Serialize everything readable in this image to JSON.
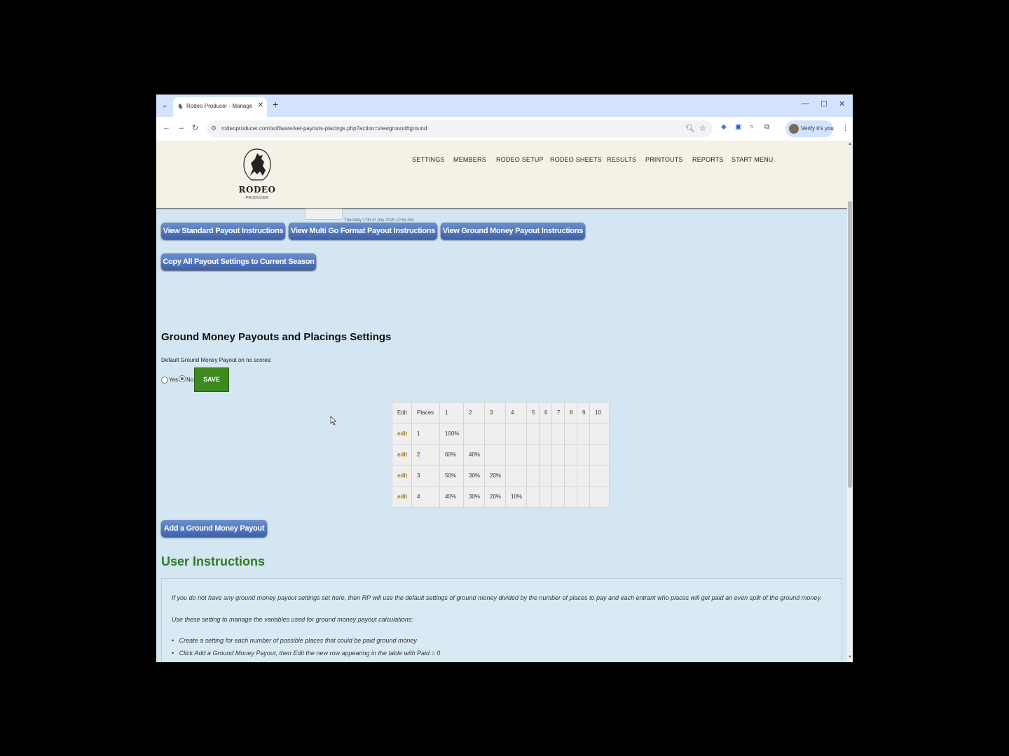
{
  "browser": {
    "tab_title": "Rodeo Producer - Manage Payo",
    "url": "rodeoproducer.com/software/set-payouts-placings.php?action=viewground#ground",
    "profile_label": "Verify it's you"
  },
  "logo": {
    "name": "RODEO",
    "sub": "PRODUCER"
  },
  "nav": [
    "SETTINGS",
    "MEMBERS",
    "RODEO SETUP",
    "RODEO SHEETS",
    "RESULTS",
    "PRINTOUTS",
    "REPORTS",
    "START MENU"
  ],
  "faded_text": "Thursday 17th of July 2025 10:54 AM",
  "buttons": {
    "standard": "View Standard Payout Instructions",
    "multigo": "View Multi Go Format Payout Instructions",
    "ground": "View Ground Money Payout Instructions",
    "copy": "Copy All Payout Settings to Current Season",
    "add": "Add a Ground Money Payout",
    "save": "SAVE"
  },
  "section_title": "Ground Money Payouts and Placings Settings",
  "default_label": "Default Ground Money Payout on no scores:",
  "radio": {
    "yes": "Yes",
    "no": "No",
    "selected": "No"
  },
  "table": {
    "headers": [
      "Edit",
      "Places",
      "1",
      "2",
      "3",
      "4",
      "5",
      "6",
      "7",
      "8",
      "9",
      "10"
    ],
    "rows": [
      [
        "edit",
        "1",
        "100%",
        "",
        "",
        "",
        "",
        "",
        "",
        "",
        "",
        ""
      ],
      [
        "edit",
        "2",
        "60%",
        "40%",
        "",
        "",
        "",
        "",
        "",
        "",
        "",
        ""
      ],
      [
        "edit",
        "3",
        "50%",
        "30%",
        "20%",
        "",
        "",
        "",
        "",
        "",
        "",
        ""
      ],
      [
        "edit",
        "4",
        "40%",
        "30%",
        "20%",
        "10%",
        "",
        "",
        "",
        "",
        "",
        ""
      ]
    ]
  },
  "user_instructions": {
    "title": "User Instructions",
    "p1": "If you do not have any ground money payout settings set here, then RP will use the default settings of ground money divided by the number of places to pay and each entrant who places will get paid an even split of the ground money.",
    "p2": "Use these setting to manage the variables used for ground money payout calculations:",
    "bullets": [
      "Create a setting for each number of possible places that could be paid ground money",
      "Click Add a Ground Money Payout, then Edit the new row appearing in the table with Paid = 0"
    ]
  }
}
